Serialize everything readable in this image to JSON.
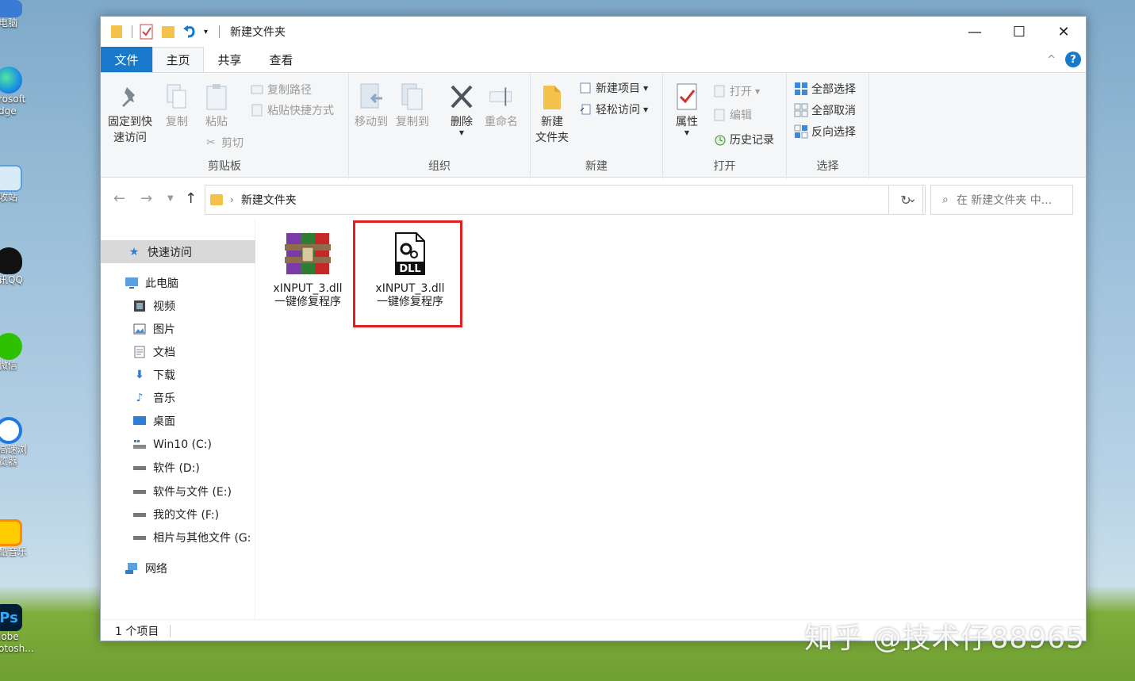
{
  "desktop": {
    "icons": [
      {
        "label": "电脑",
        "color": "#3a7bd5"
      },
      {
        "label": "rosoft",
        "color": "#1a8fe3"
      },
      {
        "label": "dge",
        "color": "#1a8fe3"
      },
      {
        "label": "收站",
        "color": "#5aa0e0"
      },
      {
        "label": "讯QQ",
        "color": "#111111"
      },
      {
        "label": "微信",
        "color": "#2dc100"
      },
      {
        "label": "高速浏",
        "color": "#1f7ae0"
      },
      {
        "label": "览器",
        "color": "#1f7ae0"
      },
      {
        "label": "酷音乐",
        "color": "#ff8a00"
      },
      {
        "label": "lobe",
        "color": "#001e36"
      },
      {
        "label": "otosh...",
        "color": "#001e36"
      }
    ],
    "watermark": "知乎 @技术仔88965"
  },
  "window": {
    "title": "新建文件夹",
    "controls": {
      "minimize": "—",
      "maximize": "☐",
      "close": "✕"
    },
    "tabs": [
      {
        "label": "文件"
      },
      {
        "label": "主页"
      },
      {
        "label": "共享"
      },
      {
        "label": "查看"
      }
    ],
    "help_label": "?",
    "collapse_label": "^"
  },
  "ribbon": {
    "clipboard": {
      "name": "剪贴板",
      "pin_line1": "固定到快",
      "pin_line2": "速访问",
      "copy": "复制",
      "paste": "粘贴",
      "copy_path": "复制路径",
      "paste_shortcut": "粘贴快捷方式",
      "cut": "剪切"
    },
    "organize": {
      "name": "组织",
      "move_to": "移动到",
      "copy_to": "复制到",
      "delete": "删除",
      "rename": "重命名"
    },
    "new": {
      "name": "新建",
      "new_folder_line1": "新建",
      "new_folder_line2": "文件夹",
      "new_item": "新建项目",
      "easy_access": "轻松访问"
    },
    "open": {
      "name": "打开",
      "properties": "属性",
      "open": "打开",
      "edit": "编辑",
      "history": "历史记录"
    },
    "select": {
      "name": "选择",
      "select_all": "全部选择",
      "select_none": "全部取消",
      "invert": "反向选择"
    }
  },
  "address": {
    "path": "新建文件夹",
    "search_placeholder": "在 新建文件夹 中..."
  },
  "nav": {
    "quick_access": "快速访问",
    "this_pc": "此电脑",
    "videos": "视频",
    "pictures": "图片",
    "documents": "文档",
    "downloads": "下载",
    "music": "音乐",
    "desktop": "桌面",
    "drive_c": "Win10 (C:)",
    "drive_d": "软件 (D:)",
    "drive_e": "软件与文件 (E:)",
    "drive_f": "我的文件 (F:)",
    "drive_g": "相片与其他文件 (G:",
    "network": "网络"
  },
  "files": [
    {
      "name_line1": "xINPUT_3.dll",
      "name_line2": "一键修复程序",
      "type": "archive"
    },
    {
      "name_line1": "xINPUT_3.dll",
      "name_line2": "一键修复程序",
      "type": "dll",
      "icon_text": "DLL"
    }
  ],
  "status": {
    "count": "1 个项目"
  },
  "colors": {
    "accent": "#1979ca",
    "highlight_box": "#e02020",
    "folder": "#f2c24a"
  }
}
